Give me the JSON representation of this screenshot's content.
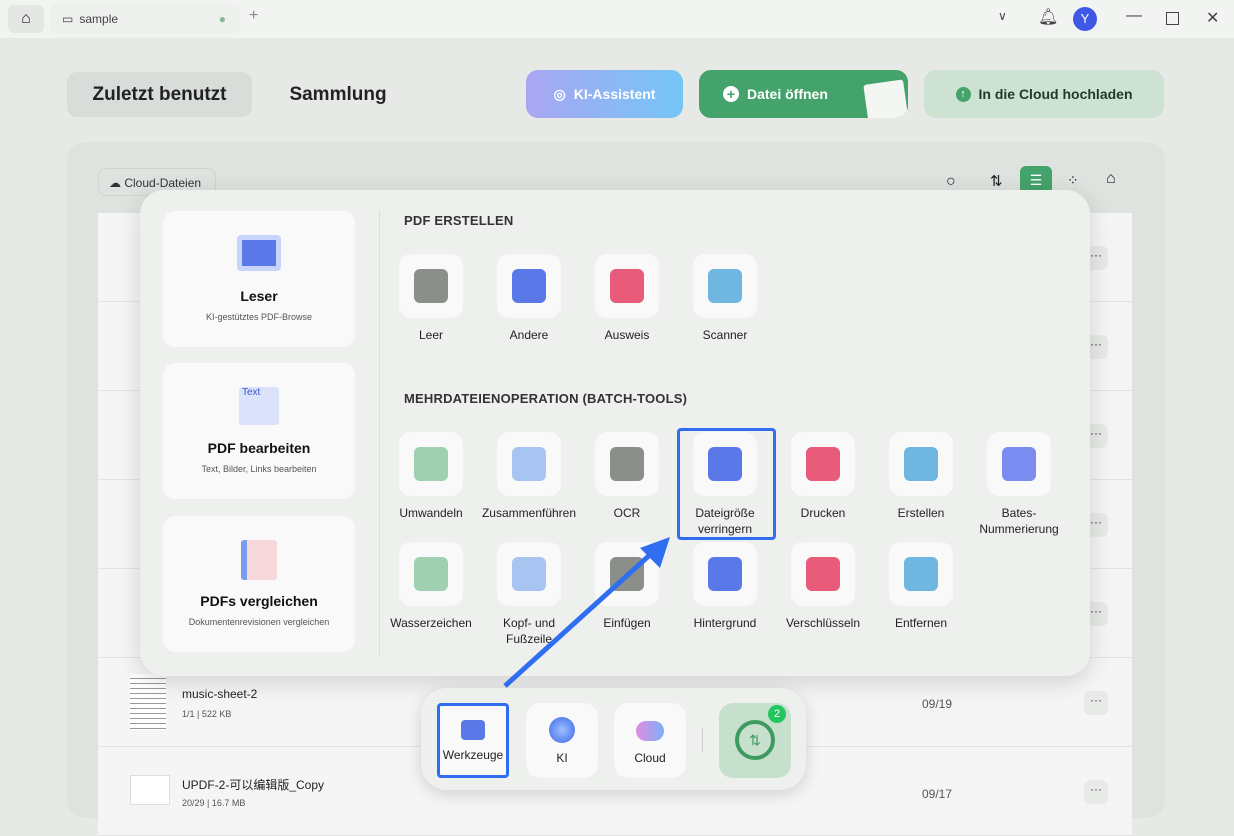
{
  "titlebar": {
    "tab": "sample",
    "avatar": "Y"
  },
  "header": {
    "tabs": [
      "Zuletzt benutzt",
      "Sammlung"
    ],
    "ki_button": "KI-Assistent",
    "open_button": "Datei öffnen",
    "upload_button": "In die Cloud hochladen"
  },
  "filter": {
    "cloud_files": "Cloud-Dateien"
  },
  "files": [
    {
      "name": "music-sheet-2",
      "meta": "1/1 | 522 KB",
      "date": "09/19"
    },
    {
      "name": "UPDF-2-可以编辑版_Copy",
      "meta": "20/29 | 16.7 MB",
      "date": "09/17"
    }
  ],
  "more_label": "···",
  "popup": {
    "cards": [
      {
        "title": "Leser",
        "subtitle": "KI-gestütztes PDF-Browse"
      },
      {
        "title": "PDF bearbeiten",
        "subtitle": "Text, Bilder, Links bearbeiten",
        "icon_text": "Text"
      },
      {
        "title": "PDFs vergleichen",
        "subtitle": "Dokumentenrevisionen vergleichen"
      }
    ],
    "create_heading": "PDF ERSTELLEN",
    "create_tools": [
      "Leer",
      "Andere",
      "Ausweis",
      "Scanner"
    ],
    "batch_heading": "MEHRDATEIENOPERATION (BATCH-TOOLS)",
    "batch_row1": [
      "Umwandeln",
      "Zusammenführen",
      "OCR",
      "Dateigröße verringern",
      "Drucken",
      "Erstellen",
      "Bates-Nummerierung"
    ],
    "batch_row2": [
      "Wasserzeichen",
      "Kopf- und Fußzeile",
      "Einfügen",
      "Hintergrund",
      "Verschlüsseln",
      "Entfernen"
    ]
  },
  "dock": {
    "tools": "Werkzeuge",
    "ki": "KI",
    "cloud": "Cloud",
    "badge": "2"
  },
  "colors": {
    "accent": "#2f6ef0",
    "green": "#44a36a"
  }
}
